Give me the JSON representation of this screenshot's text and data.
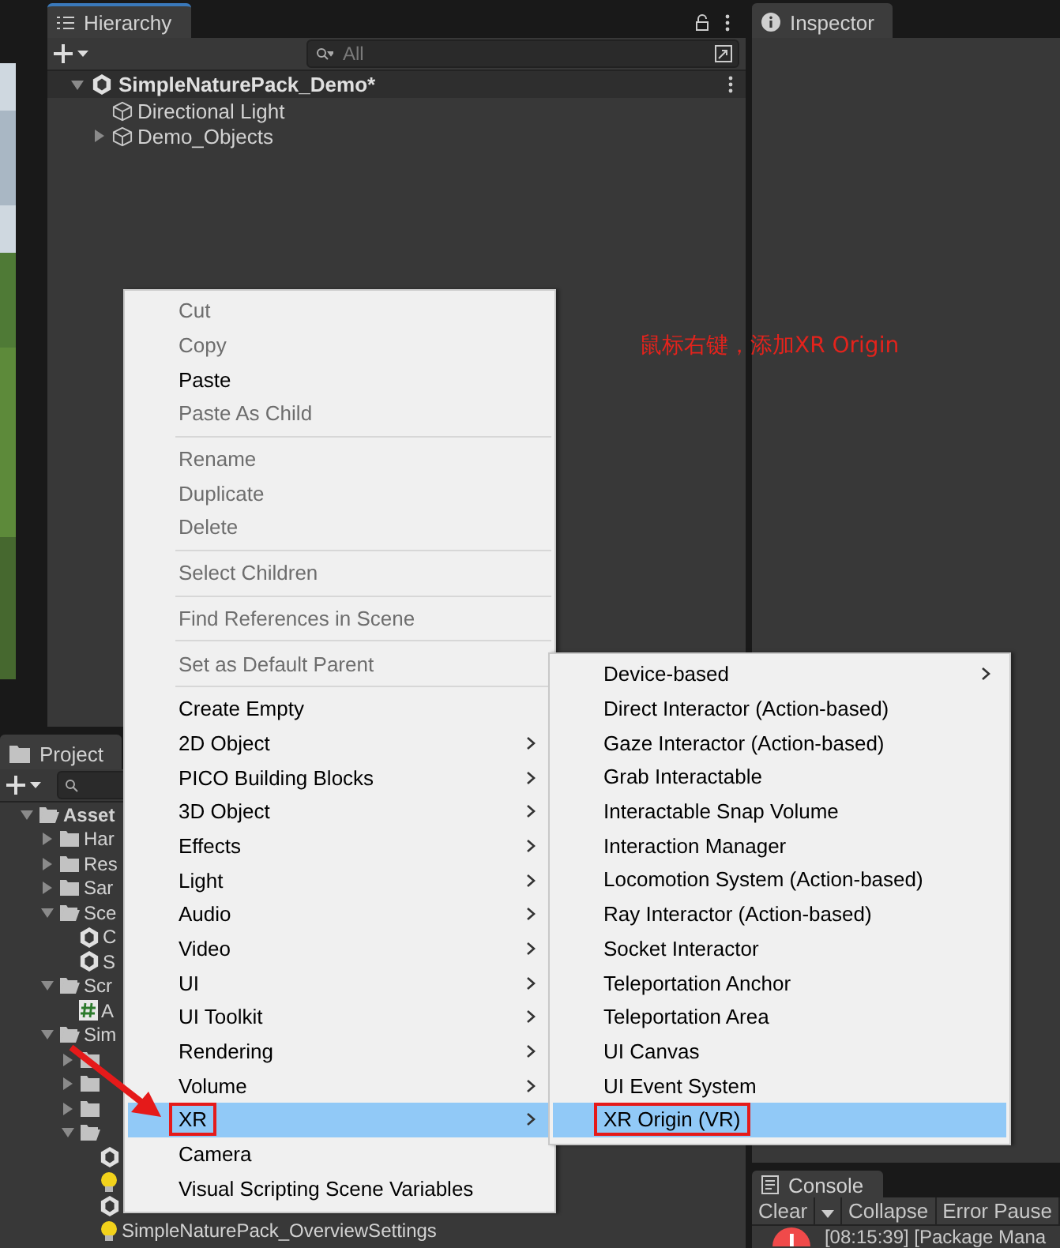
{
  "hierarchy": {
    "tab": "Hierarchy",
    "search": {
      "placeholder": "All"
    },
    "scene": {
      "name": "SimpleNaturePack_Demo*",
      "expanded": true,
      "children": [
        {
          "name": "Directional Light",
          "has_children": false
        },
        {
          "name": "Demo_Objects",
          "has_children": true,
          "expanded": false
        }
      ]
    }
  },
  "inspector": {
    "tab": "Inspector"
  },
  "project": {
    "tab": "Project",
    "tree": [
      {
        "kind": "folder",
        "label": "Asset",
        "bold": true,
        "expanded": true,
        "children": [
          {
            "kind": "folder",
            "label": "Har",
            "expanded": false,
            "has_children": true
          },
          {
            "kind": "folder",
            "label": "Res",
            "expanded": false,
            "has_children": true
          },
          {
            "kind": "folder",
            "label": "Sar",
            "expanded": false,
            "has_children": true
          },
          {
            "kind": "folder",
            "label": "Sce",
            "expanded": true,
            "children": [
              {
                "kind": "scene",
                "label": "C"
              },
              {
                "kind": "scene",
                "label": "S"
              }
            ]
          },
          {
            "kind": "folder",
            "label": "Scr",
            "expanded": true,
            "children": [
              {
                "kind": "script",
                "label": "A"
              }
            ]
          },
          {
            "kind": "folder",
            "label": "Sim",
            "expanded": true,
            "children": [
              {
                "kind": "folder",
                "expanded": false,
                "has_children": true
              },
              {
                "kind": "folder",
                "expanded": false,
                "has_children": true
              },
              {
                "kind": "folder",
                "expanded": false,
                "has_children": true
              },
              {
                "kind": "folder",
                "expanded": true,
                "children": [
                  {
                    "kind": "scene"
                  },
                  {
                    "kind": "light"
                  },
                  {
                    "kind": "scene"
                  },
                  {
                    "kind": "light",
                    "label": "SimpleNaturePack_OverviewSettings"
                  }
                ]
              }
            ]
          }
        ]
      }
    ]
  },
  "console": {
    "tab": "Console",
    "buttons": [
      "Clear",
      "Collapse",
      "Error Pause"
    ],
    "log": "[08:15:39] [Package Mana"
  },
  "annotation": "鼠标右键，添加XR Origin",
  "context_menu": [
    {
      "kind": "item",
      "label": "Cut",
      "disabled": true
    },
    {
      "kind": "item",
      "label": "Copy",
      "disabled": true
    },
    {
      "kind": "item",
      "label": "Paste",
      "disabled": false
    },
    {
      "kind": "item",
      "label": "Paste As Child",
      "disabled": true
    },
    {
      "kind": "separator"
    },
    {
      "kind": "item",
      "label": "Rename",
      "disabled": true
    },
    {
      "kind": "item",
      "label": "Duplicate",
      "disabled": true
    },
    {
      "kind": "item",
      "label": "Delete",
      "disabled": true
    },
    {
      "kind": "separator"
    },
    {
      "kind": "item",
      "label": "Select Children",
      "disabled": true
    },
    {
      "kind": "separator"
    },
    {
      "kind": "item",
      "label": "Find References in Scene",
      "disabled": true
    },
    {
      "kind": "separator"
    },
    {
      "kind": "item",
      "label": "Set as Default Parent",
      "disabled": true
    },
    {
      "kind": "separator"
    },
    {
      "kind": "item",
      "label": "Create Empty",
      "disabled": false
    },
    {
      "kind": "submenu",
      "label": "2D Object",
      "selected": false
    },
    {
      "kind": "submenu",
      "label": "PICO Building Blocks",
      "selected": false
    },
    {
      "kind": "submenu",
      "label": "3D Object",
      "selected": false
    },
    {
      "kind": "submenu",
      "label": "Effects",
      "selected": false
    },
    {
      "kind": "submenu",
      "label": "Light",
      "selected": false
    },
    {
      "kind": "submenu",
      "label": "Audio",
      "selected": false
    },
    {
      "kind": "submenu",
      "label": "Video",
      "selected": false
    },
    {
      "kind": "submenu",
      "label": "UI",
      "selected": false
    },
    {
      "kind": "submenu",
      "label": "UI Toolkit",
      "selected": false
    },
    {
      "kind": "submenu",
      "label": "Rendering",
      "selected": false
    },
    {
      "kind": "submenu",
      "label": "Volume",
      "selected": false
    },
    {
      "kind": "submenu",
      "label": "XR",
      "selected": true,
      "annotated": true
    },
    {
      "kind": "item",
      "label": "Camera",
      "disabled": false
    },
    {
      "kind": "item",
      "label": "Visual Scripting Scene Variables",
      "disabled": false
    }
  ],
  "xr_submenu": [
    {
      "kind": "submenu",
      "label": "Device-based",
      "selected": false
    },
    {
      "kind": "item",
      "label": "Direct Interactor (Action-based)",
      "selected": false
    },
    {
      "kind": "item",
      "label": "Gaze Interactor (Action-based)",
      "selected": false
    },
    {
      "kind": "item",
      "label": "Grab Interactable",
      "selected": false
    },
    {
      "kind": "item",
      "label": "Interactable Snap Volume",
      "selected": false
    },
    {
      "kind": "item",
      "label": "Interaction Manager",
      "selected": false
    },
    {
      "kind": "item",
      "label": "Locomotion System (Action-based)",
      "selected": false
    },
    {
      "kind": "item",
      "label": "Ray Interactor (Action-based)",
      "selected": false
    },
    {
      "kind": "item",
      "label": "Socket Interactor",
      "selected": false
    },
    {
      "kind": "item",
      "label": "Teleportation Anchor",
      "selected": false
    },
    {
      "kind": "item",
      "label": "Teleportation Area",
      "selected": false
    },
    {
      "kind": "item",
      "label": "UI Canvas",
      "selected": false
    },
    {
      "kind": "item",
      "label": "UI Event System",
      "selected": false
    },
    {
      "kind": "item",
      "label": "XR Origin (VR)",
      "selected": true,
      "annotated": true
    }
  ]
}
